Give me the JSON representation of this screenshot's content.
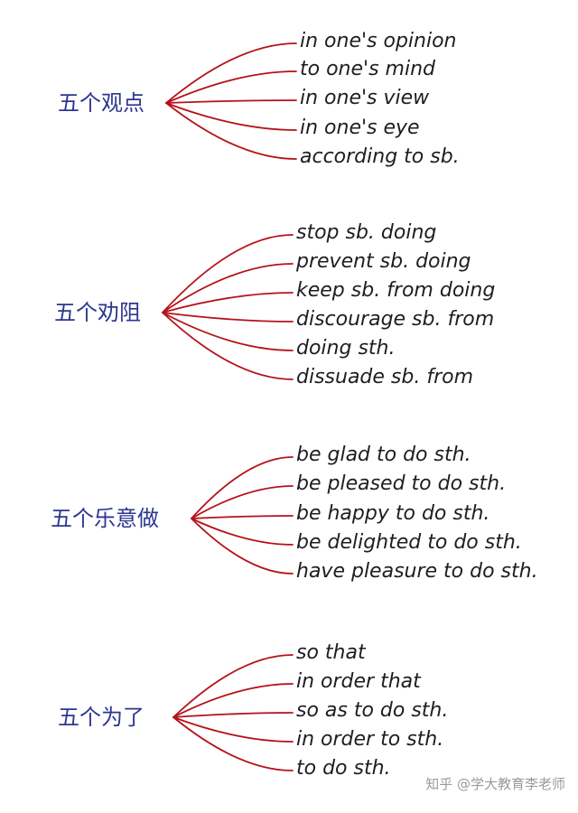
{
  "groups": [
    {
      "label": "五个观点",
      "phrases": [
        "in one's opinion",
        "to one's mind",
        "in one's view",
        "in one's eye",
        "according to sb."
      ]
    },
    {
      "label": "五个劝阻",
      "phrases": [
        "stop sb. doing",
        "prevent sb. doing",
        "keep sb. from doing",
        "discourage sb. from",
        "doing sth.",
        "dissuade sb. from"
      ]
    },
    {
      "label": "五个乐意做",
      "phrases": [
        "be glad to do sth.",
        "be pleased to do sth.",
        "be happy to do sth.",
        "be delighted to do sth.",
        "have pleasure to do sth."
      ]
    },
    {
      "label": "五个为了",
      "phrases": [
        "so that",
        "in order that",
        "so as to do sth.",
        "in order to sth.",
        "to do sth."
      ]
    }
  ],
  "watermark": "知乎 @学大教育李老师",
  "colors": {
    "label": "#2c3691",
    "line": "#b5121b",
    "phrase": "#1e1e1e"
  }
}
